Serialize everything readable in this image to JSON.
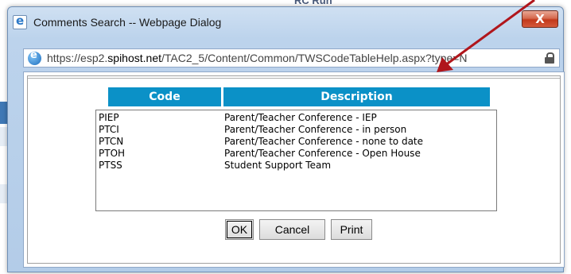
{
  "background": {
    "top_text": "RC Run"
  },
  "dialog": {
    "title": "Comments Search -- Webpage Dialog",
    "close_symbol": "X",
    "address": {
      "scheme": "https://",
      "host_prefix": "esp2.",
      "host_domain": "spihost.net",
      "path": "/TAC2_5/Content/Common/TWSCodeTableHelp.aspx?type=N"
    }
  },
  "table": {
    "headers": {
      "code": "Code",
      "description": "Description"
    },
    "rows": [
      {
        "code": "PIEP",
        "description": "Parent/Teacher Conference - IEP"
      },
      {
        "code": "PTCI",
        "description": "Parent/Teacher Conference - in person"
      },
      {
        "code": "PTCN",
        "description": "Parent/Teacher Conference - none to date"
      },
      {
        "code": "PTOH",
        "description": "Parent/Teacher Conference - Open House"
      },
      {
        "code": "PTSS",
        "description": "Student Support Team"
      }
    ]
  },
  "buttons": {
    "ok": "OK",
    "cancel": "Cancel",
    "print": "Print"
  },
  "colors": {
    "header_blue": "#0b91c7",
    "arrow_red": "#b0161c",
    "close_red": "#c2391b"
  }
}
